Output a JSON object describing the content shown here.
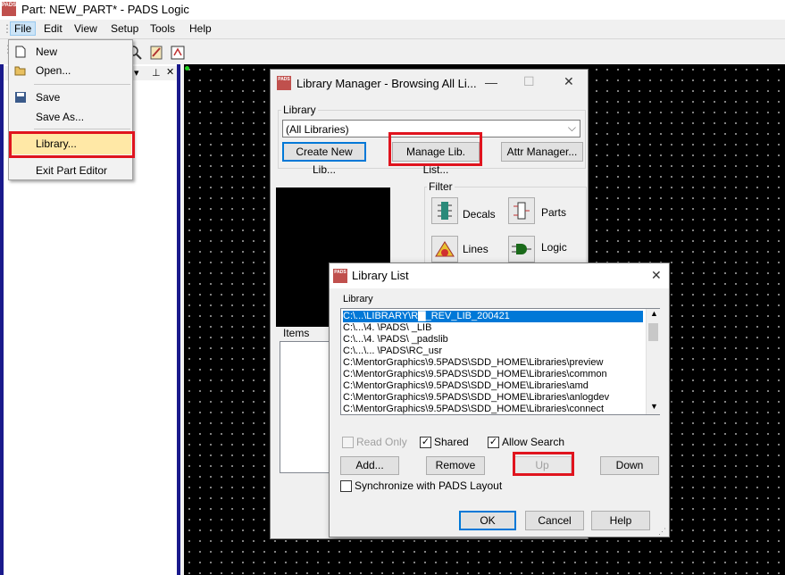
{
  "app": {
    "title": "Part: NEW_PART* - PADS Logic",
    "icon_text": "PADS"
  },
  "menubar": [
    "File",
    "Edit",
    "View",
    "Setup",
    "Tools",
    "Help"
  ],
  "file_menu": {
    "items": [
      "New",
      "Open...",
      "Save",
      "Save As...",
      "Library...",
      "Exit Part Editor"
    ]
  },
  "library_manager": {
    "title": "Library Manager - Browsing All Li...",
    "library_label": "Library",
    "library_value": "(All Libraries)",
    "create_new_lib": "Create New Lib...",
    "manage_lib_list": "Manage Lib. List...",
    "attr_manager": "Attr Manager...",
    "filter_label": "Filter",
    "filters": [
      "Decals",
      "Parts",
      "Lines",
      "Logic"
    ],
    "items_label": "Items"
  },
  "library_list": {
    "title": "Library List",
    "library_label": "Library",
    "rows": [
      "C:\\...\\LIBRARY\\R▇_REV_LIB_200421",
      "C:\\...\\4.                \\PADS\\    _LIB",
      "C:\\...\\4.                \\PADS\\    _padslib",
      "C:\\...\\...                \\PADS\\RC_usr",
      "C:\\MentorGraphics\\9.5PADS\\SDD_HOME\\Libraries\\preview",
      "C:\\MentorGraphics\\9.5PADS\\SDD_HOME\\Libraries\\common",
      "C:\\MentorGraphics\\9.5PADS\\SDD_HOME\\Libraries\\amd",
      "C:\\MentorGraphics\\9.5PADS\\SDD_HOME\\Libraries\\anlogdev",
      "C:\\MentorGraphics\\9.5PADS\\SDD_HOME\\Libraries\\connect"
    ],
    "read_only": "Read Only",
    "shared": "Shared",
    "allow_search": "Allow Search",
    "add": "Add...",
    "remove": "Remove",
    "up": "Up",
    "down": "Down",
    "sync": "Synchronize with PADS Layout",
    "ok": "OK",
    "cancel": "Cancel",
    "help": "Help"
  },
  "colors": {
    "highlight_red": "#e0141e",
    "selection_blue": "#0078d7",
    "canvas": "#000000"
  }
}
